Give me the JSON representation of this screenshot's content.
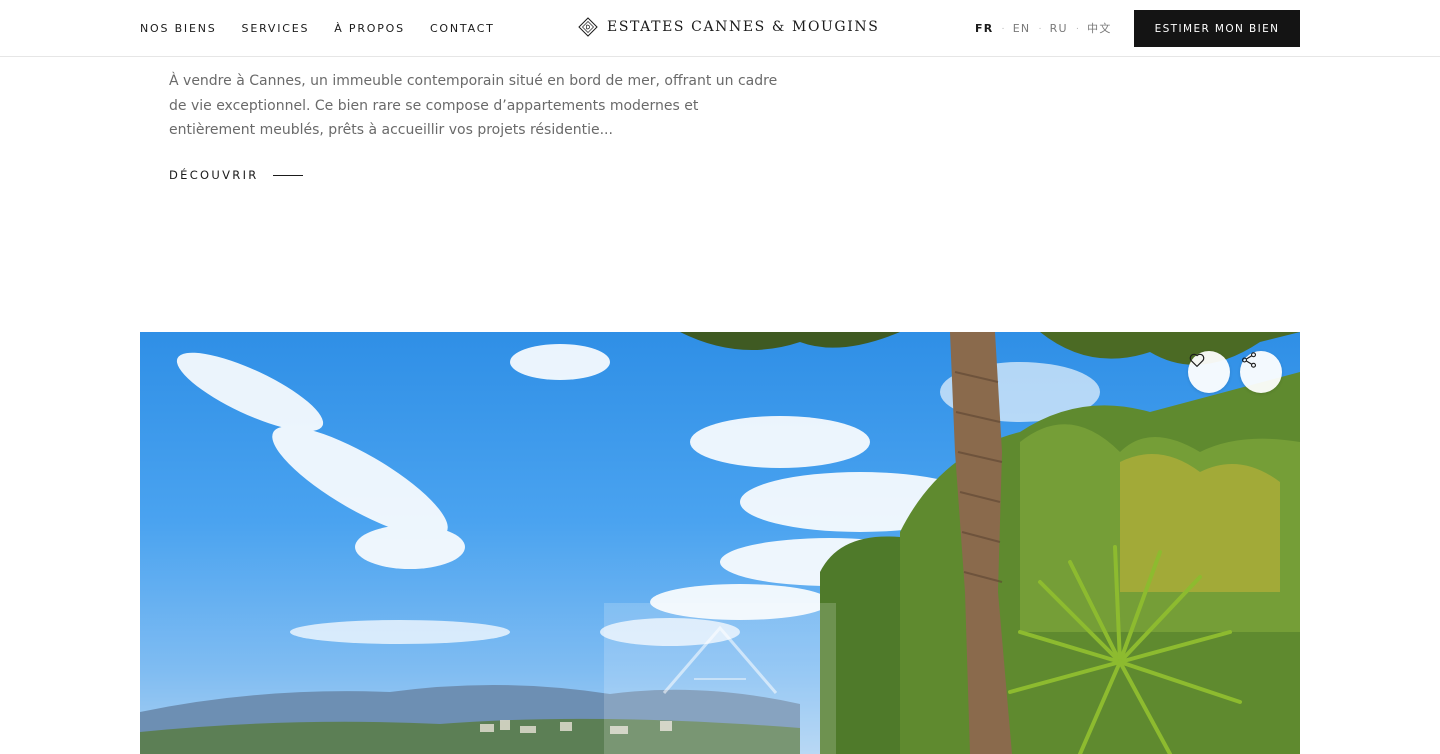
{
  "header": {
    "nav": [
      "NOS BIENS",
      "SERVICES",
      "À PROPOS",
      "CONTACT"
    ],
    "brand": "ESTATES CANNES & MOUGINS",
    "languages": [
      {
        "code": "FR",
        "active": true
      },
      {
        "code": "EN",
        "active": false
      },
      {
        "code": "RU",
        "active": false
      },
      {
        "code": "中文",
        "active": false
      }
    ],
    "cta_label": "ESTIMER MON BIEN"
  },
  "listing": {
    "description": "À vendre à Cannes, un immeuble contemporain situé en bord de mer, offrant un cadre de vie exceptionnel. Ce bien rare se compose d’appartements modernes et entièrement meublés, prêts à accueillir vos projets résidentie...",
    "discover_label": "DÉCOUVRIR"
  },
  "photo_card": {
    "favorite_icon": "heart-icon",
    "share_icon": "share-icon",
    "watermark_icon": "house-logo-icon"
  },
  "colors": {
    "cta_background": "#141414",
    "text": "#1b1b1b",
    "muted_text": "#6a6a6a",
    "sky": "#4aa3f0",
    "foliage": "#5f8a2f"
  }
}
